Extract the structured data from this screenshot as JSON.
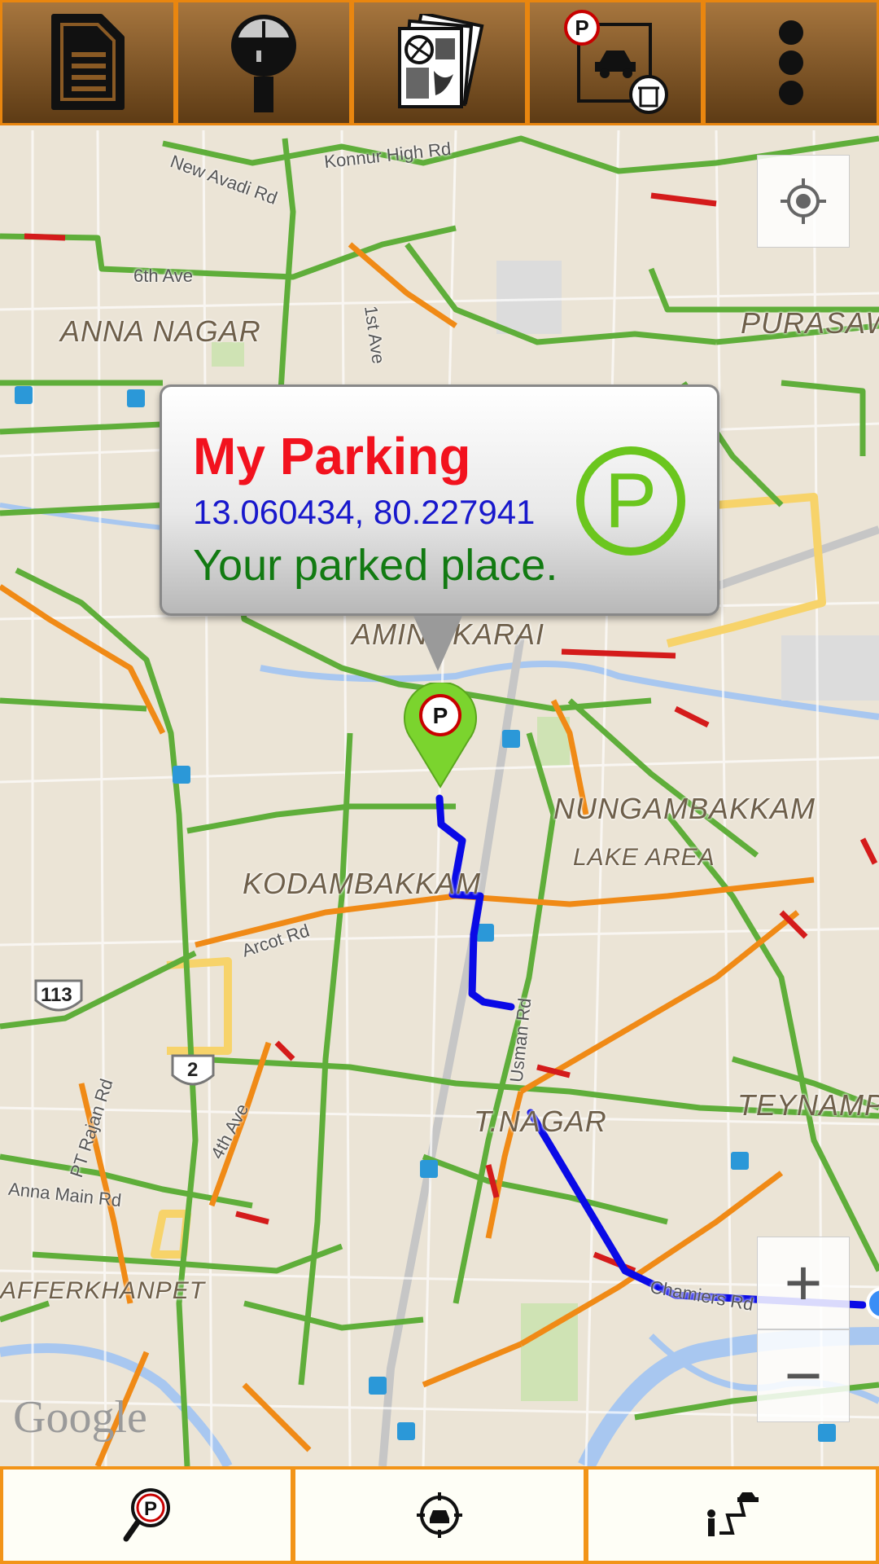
{
  "toolbar": {
    "buttons": [
      {
        "icon": "document-icon"
      },
      {
        "icon": "parking-meter-icon"
      },
      {
        "icon": "maps-icon"
      },
      {
        "icon": "clear-parking-icon"
      },
      {
        "icon": "overflow-menu-icon"
      }
    ]
  },
  "map": {
    "places": {
      "anna_nagar": "ANNA NAGAR",
      "purasawalkam": "PURASAWA",
      "aminjikarai": "AMINJIKARAI",
      "nungambakkam": "NUNGAMBAKKAM",
      "lake_area": "LAKE AREA",
      "kodambakkam": "KODAMBAKKAM",
      "t_nagar": "T.NAGAR",
      "teynampet": "TEYNAMPE",
      "saidapet": "AFFERKHANPET"
    },
    "streets": {
      "new_avadi": "New Avadi Rd",
      "konnur": "Konnur High Rd",
      "sixth_ave": "6th Ave",
      "first_ave": "1st Ave",
      "arcot": "Arcot Rd",
      "pt_rajan": "PT Rajan Rd",
      "fourth_ave": "4th Ave",
      "anna_main": "Anna Main Rd",
      "usman": "Usman Rd",
      "chamiers": "Chamiers Rd"
    },
    "shields": {
      "a": "113",
      "b": "2"
    },
    "attribution": "Google",
    "zoom_in": "+",
    "zoom_out": "−"
  },
  "info_window": {
    "title": "My Parking",
    "coordinates": "13.060434, 80.227941",
    "description": "Your parked place."
  },
  "bottom_bar": {
    "buttons": [
      {
        "icon": "find-parking-icon"
      },
      {
        "icon": "locate-car-icon"
      },
      {
        "icon": "walk-route-icon"
      }
    ]
  },
  "colors": {
    "accent": "#f29418",
    "title_red": "#f2121e",
    "coords_blue": "#1818cc",
    "desc_green": "#127a12",
    "parking_green": "#6bc61e",
    "route_blue": "#0a0ae6"
  }
}
